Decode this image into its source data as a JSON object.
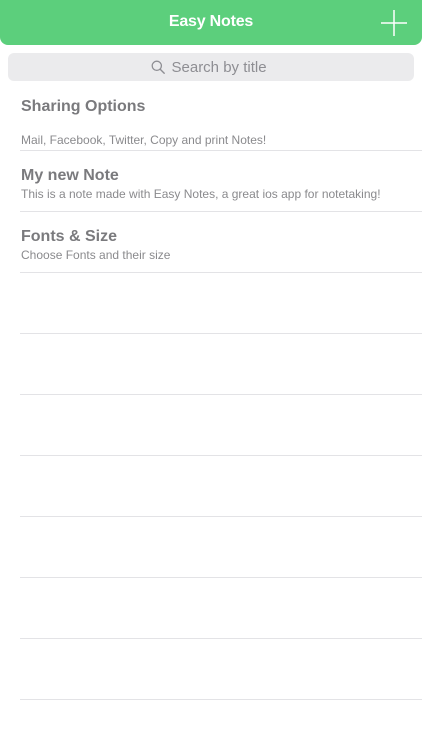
{
  "navbar": {
    "title": "Easy Notes",
    "add_icon": "plus-icon",
    "color": "#5ccf7c"
  },
  "search": {
    "placeholder": "Search by title",
    "icon": "search-icon"
  },
  "notes": [
    {
      "title": "Sharing Options",
      "subtitle": "Mail, Facebook, Twitter, Copy and print Notes!"
    },
    {
      "title": "My new Note",
      "subtitle": "This is a note made with Easy Notes, a great ios app for notetaking!"
    },
    {
      "title": "Fonts & Size",
      "subtitle": "Choose Fonts and their size"
    }
  ]
}
